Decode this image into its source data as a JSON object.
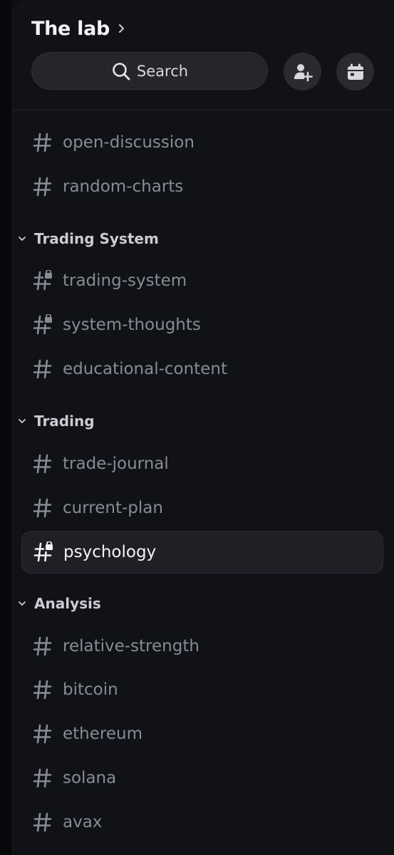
{
  "server": {
    "name": "The lab"
  },
  "search": {
    "label": "Search"
  },
  "actions": {
    "invite_icon": "add-user-icon",
    "events_icon": "calendar-icon"
  },
  "channels_top": [
    {
      "name": "open-discussion",
      "locked": false
    },
    {
      "name": "random-charts",
      "locked": false
    }
  ],
  "categories": [
    {
      "label": "Trading System",
      "channels": [
        {
          "name": "trading-system",
          "locked": true
        },
        {
          "name": "system-thoughts",
          "locked": true
        },
        {
          "name": "educational-content",
          "locked": false
        }
      ]
    },
    {
      "label": "Trading",
      "channels": [
        {
          "name": "trade-journal",
          "locked": false
        },
        {
          "name": "current-plan",
          "locked": false
        },
        {
          "name": "psychology",
          "locked": true,
          "selected": true
        }
      ]
    },
    {
      "label": "Analysis",
      "channels": [
        {
          "name": "relative-strength",
          "locked": false
        },
        {
          "name": "bitcoin",
          "locked": false
        },
        {
          "name": "ethereum",
          "locked": false
        },
        {
          "name": "solana",
          "locked": false
        },
        {
          "name": "avax",
          "locked": false
        }
      ]
    }
  ],
  "colors": {
    "background": "#111216",
    "text_muted": "#878b95",
    "text_active": "#f2f3f5",
    "selected_bg": "#1f2026"
  }
}
